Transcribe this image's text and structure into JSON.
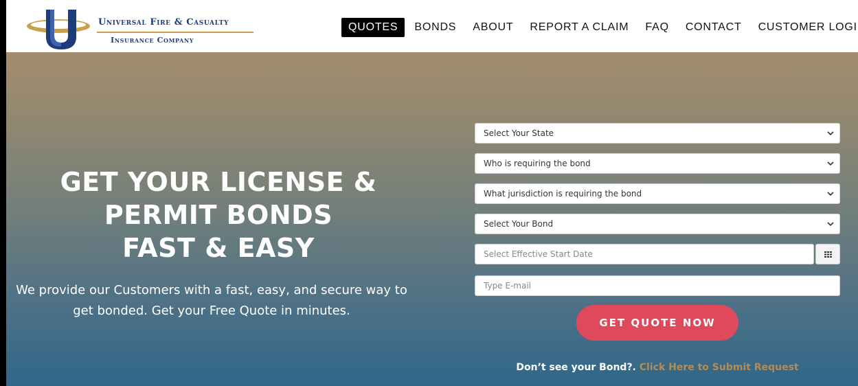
{
  "brand": {
    "line1": "Universal Fire & Casualty",
    "line2": "Insurance Company",
    "colors": {
      "navy": "#1c3d7a",
      "gold": "#c9a04a"
    }
  },
  "nav": {
    "items": [
      {
        "label": "QUOTES",
        "active": true
      },
      {
        "label": "BONDS",
        "active": false
      },
      {
        "label": "ABOUT",
        "active": false
      },
      {
        "label": "REPORT A CLAIM",
        "active": false
      },
      {
        "label": "FAQ",
        "active": false
      },
      {
        "label": "CONTACT",
        "active": false
      },
      {
        "label": "CUSTOMER LOGIN",
        "active": false
      }
    ]
  },
  "hero": {
    "title_lines": [
      "GET YOUR LICENSE &",
      "PERMIT BONDS",
      "FAST & EASY"
    ],
    "subtitle": "We provide our Customers with a fast, easy, and secure way to get bonded. Get your Free Quote in minutes."
  },
  "form": {
    "state_select": "Select Your State",
    "requirer_select": "Who is requiring the bond",
    "jurisdiction_select": "What jurisdiction is requiring the bond",
    "bond_select": "Select Your Bond",
    "start_date_placeholder": "Select Effective Start Date",
    "email_placeholder": "Type E-mail",
    "submit_label": "GET QUOTE NOW",
    "calendar_icon": "calendar-grid-icon",
    "select_icon": "chevron-down-icon"
  },
  "request": {
    "prompt": "Don’t see your Bond?.",
    "link_text": "Click Here to Submit Request"
  },
  "colors": {
    "button": "#de4a5c",
    "link": "#b58b54",
    "nav_active_bg": "#000000"
  }
}
